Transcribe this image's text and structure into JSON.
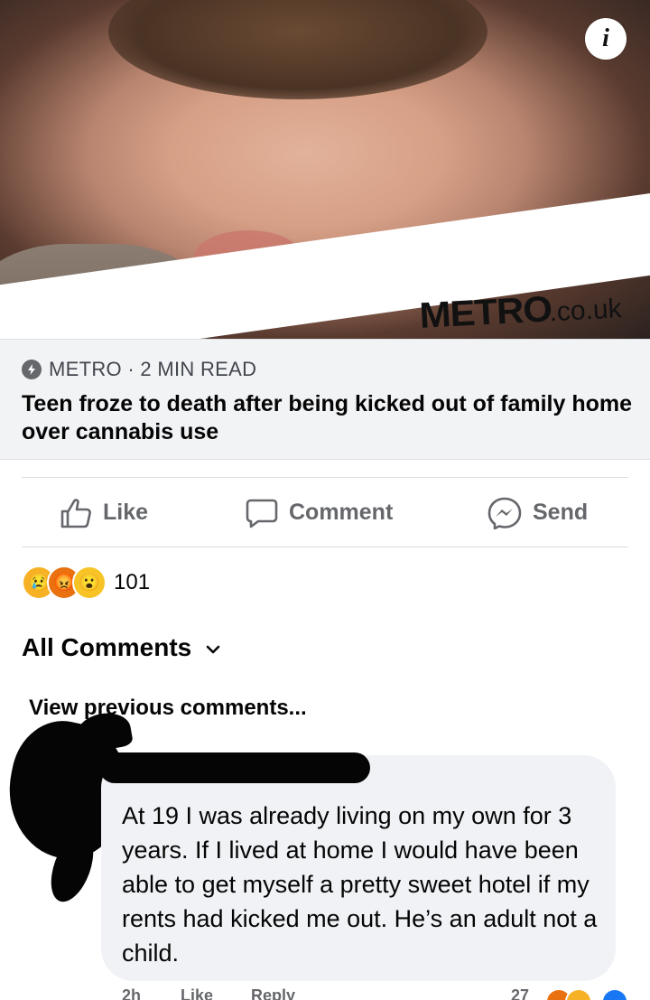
{
  "post": {
    "link_preview": {
      "image_alt": "Selfie of young man",
      "watermark_main": "METRO",
      "watermark_suffix": ".co.uk",
      "info_icon": "info-icon",
      "source": "METRO · 2 MIN READ",
      "headline": "Teen froze to death after being kicked out of family home over cannabis use"
    },
    "actions": {
      "like": "Like",
      "comment": "Comment",
      "send": "Send"
    },
    "reactions": {
      "icons": [
        "sad-reaction-icon",
        "angry-reaction-icon",
        "wow-reaction-icon"
      ],
      "count": "101"
    },
    "comments": {
      "filter_label": "All Comments",
      "view_previous": "View previous comments...",
      "items": [
        {
          "author": "",
          "text": "At 19 I was already living on my own for 3 years. If I lived at home I would have been able to get myself a pretty sweet hotel if my rents had kicked me out. He’s an adult not a child.",
          "time": "2h",
          "like": "Like",
          "reply": "Reply",
          "reaction_count": "27"
        }
      ]
    }
  },
  "colors": {
    "card_bg": "#f2f3f5",
    "bubble_bg": "#f0f2f5",
    "muted": "#65676b",
    "text": "#050505"
  }
}
